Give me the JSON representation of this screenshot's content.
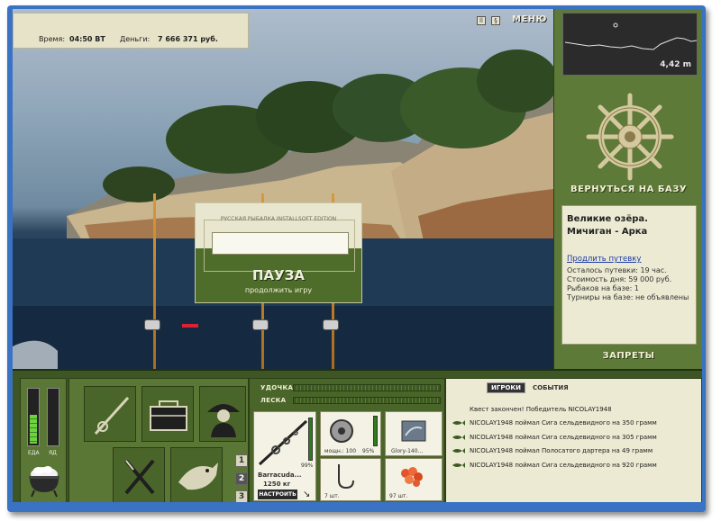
{
  "top": {
    "time_label": "Время:",
    "time_value": "04:50 ВТ",
    "money_label": "Деньги:",
    "money_value": "7 666 371 руб.",
    "menu_label": "МЕНЮ"
  },
  "depth": {
    "value": "4,42 m"
  },
  "base": {
    "return_label": "ВЕРНУТЬСЯ НА БАЗУ",
    "location": "Великие озёра. Мичиган - Арка",
    "extend_link": "Продлить путевку",
    "remaining": "Осталось путевки: 19 час.",
    "day_cost": "Стоимость дня: 59 000 руб.",
    "anglers": "Рыбаков на базе: 1",
    "tournaments": "Турниры на базе: не объявлены",
    "bans_label": "ЗАПРЕТЫ"
  },
  "pause": {
    "brand": "РУССКАЯ РЫБАЛКА INSTALLSOFT EDITION",
    "title": "ПАУЗА",
    "continue": "продолжить игру"
  },
  "meters": {
    "food_label": "ЕДА",
    "poison_label": "ЯД",
    "food_level": 0.55,
    "poison_level": 0.0
  },
  "tools": {
    "pages": [
      "1",
      "2",
      "3"
    ],
    "active_page": 1
  },
  "gear": {
    "rod_label": "УДОЧКА",
    "line_label": "ЛЕСКА",
    "rod_name": "Barracuda...",
    "rod_load": "1250 кг",
    "rod_percent": "99%",
    "reel_power": "мощн.: 100",
    "reel_percent": "95%",
    "lure_name": "Glory-140...",
    "hook_count": "7 шт.",
    "bait_count": "97 шт.",
    "tune_label": "НАСТРОИТЬ"
  },
  "events": {
    "tab_players": "ИГРОКИ",
    "tab_events": "СОБЫТИЯ",
    "items": [
      "Квест закончен! Победитель NICOLAY1948",
      "NICOLAY1948 поймал Сига сельдевидного на 350 грамм",
      "NICOLAY1948 поймал Сига сельдевидного на 305 грамм",
      "NICOLAY1948 поймал Полосатого дартера на 49 грамм",
      "NICOLAY1948 поймал Сига сельдевидного на 920 грамм"
    ]
  }
}
